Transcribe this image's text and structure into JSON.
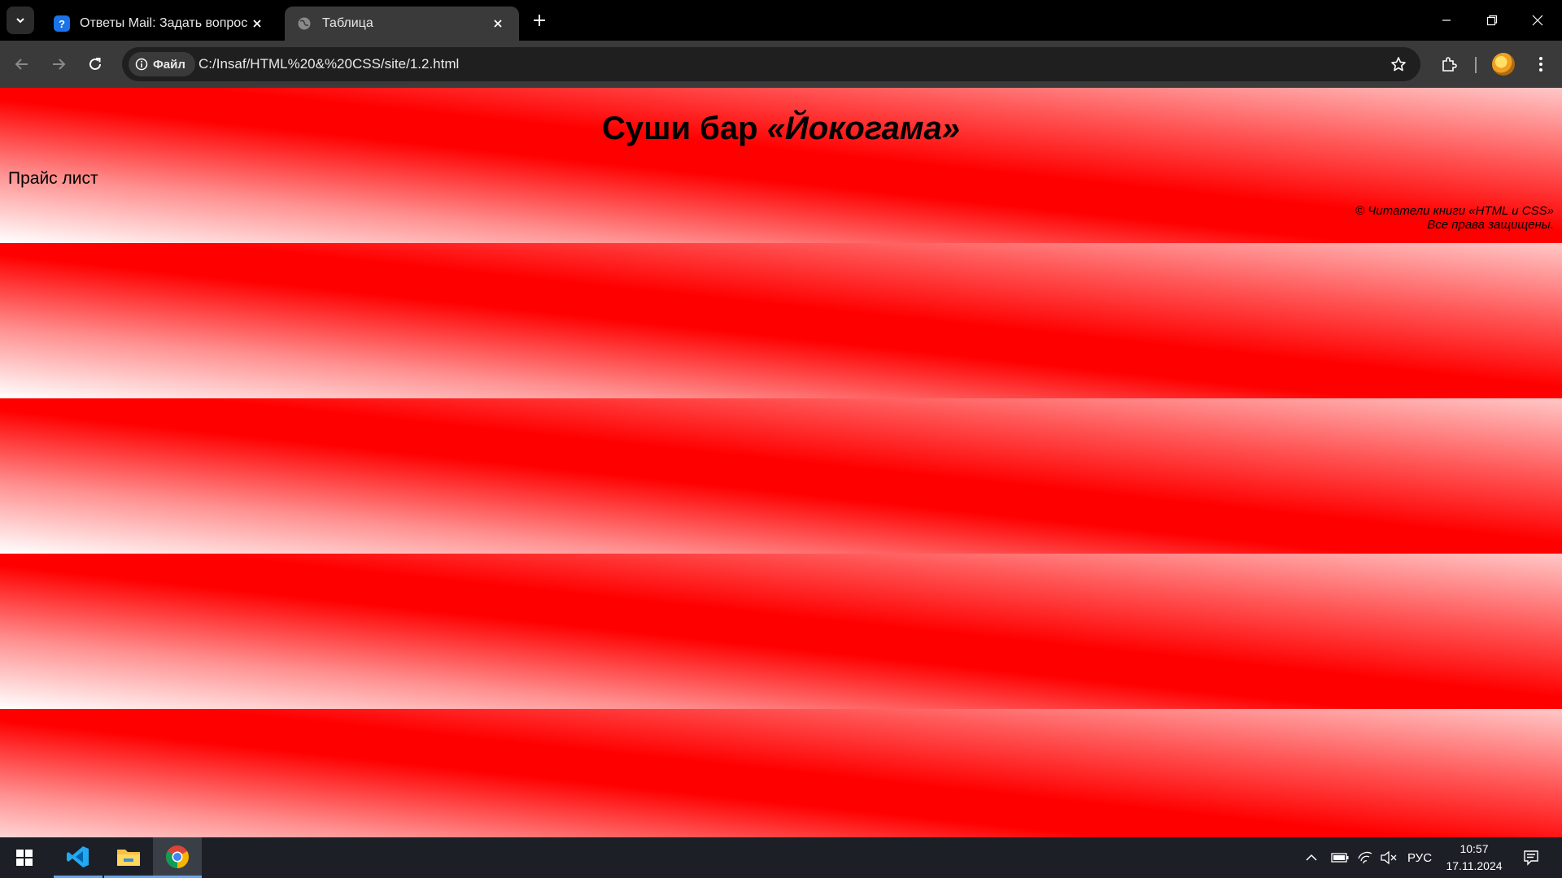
{
  "browser": {
    "tabs": [
      {
        "title": "Ответы Mail: Задать вопрос",
        "icon": "mail-answers-favicon",
        "active": false
      },
      {
        "title": "Таблица",
        "icon": "globe-icon",
        "active": true
      }
    ],
    "site_chip_label": "Файл",
    "url": "C:/Insaf/HTML%20&%20CSS/site/1.2.html"
  },
  "page": {
    "title_plain": "Суши бар ",
    "title_brand": "«Йокогама»",
    "price_label": "Прайс лист",
    "copyright_line1": "© Читатели книги «HTML и CSS»",
    "copyright_line2": "Все права защищены.",
    "background_colors": [
      "#ffffff",
      "#ff0000"
    ]
  },
  "taskbar": {
    "apps": [
      "windows-start",
      "vscode",
      "file-explorer",
      "chrome"
    ],
    "language": "РУС",
    "time": "10:57",
    "date": "17.11.2024"
  }
}
